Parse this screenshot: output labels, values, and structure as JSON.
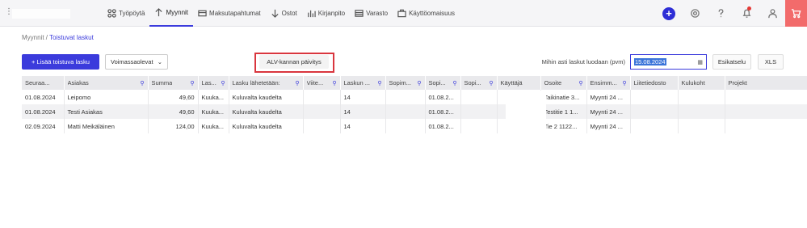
{
  "nav": {
    "items": [
      {
        "label": "Työpöytä",
        "icon": "dashboard-icon"
      },
      {
        "label": "Myynnit",
        "icon": "arrow-up-icon",
        "active": true
      },
      {
        "label": "Maksutapahtumat",
        "icon": "card-icon"
      },
      {
        "label": "Ostot",
        "icon": "arrow-down-icon"
      },
      {
        "label": "Kirjanpito",
        "icon": "bar-chart-icon"
      },
      {
        "label": "Varasto",
        "icon": "warehouse-icon"
      },
      {
        "label": "Käyttöomaisuus",
        "icon": "briefcase-icon"
      }
    ]
  },
  "breadcrumb": {
    "parent": "Myynnit",
    "sep": "/",
    "current": "Toistuvat laskut"
  },
  "toolbar": {
    "add_label": "+ Lisää toistuva lasku",
    "filter_value": "Voimassaolevat",
    "alv_label": "ALV-kannan päivitys",
    "date_label": "Mihin asti laskut luodaan (pvm)",
    "date_value": "15.08.2024",
    "preview_label": "Esikatselu",
    "xls_label": "XLS"
  },
  "table": {
    "columns": [
      "Seuraa...",
      "Asiakas",
      "Summa",
      "Las...",
      "Lasku lähetetään:",
      "Viite...",
      "Laskun ...",
      "Sopim...",
      "Sopi...",
      "Sopi...",
      "Käyttäjä",
      "Osoite",
      "Ensimm...",
      "Liitetiedosto",
      "Kulukoht",
      "Projekt"
    ],
    "rows": [
      [
        "01.08.2024",
        "Leipomo",
        "49,60",
        "Kuuka...",
        "Kuluvalta kaudelta",
        "",
        "14",
        "",
        "01.08.2...",
        "",
        "",
        "Taikinatie 3...",
        "Myynti 24 ...",
        "",
        "",
        ""
      ],
      [
        "01.08.2024",
        "Testi Asiakas",
        "49,60",
        "Kuuka...",
        "Kuluvalta kaudelta",
        "",
        "14",
        "",
        "01.08.2...",
        "",
        "",
        "Testitie 1 1...",
        "Myynti 24 ...",
        "",
        "",
        ""
      ],
      [
        "02.09.2024",
        "Matti Meikäläinen",
        "124,00",
        "Kuuka...",
        "Kuluvalta kaudelta",
        "",
        "14",
        "",
        "01.08.2...",
        "",
        "",
        "Tie 2 1122...",
        "Myynti 24 ...",
        "",
        "",
        ""
      ]
    ]
  },
  "colors": {
    "accent": "#3b3bdc",
    "highlight": "#d9363e",
    "cart": "#f26b6b"
  }
}
